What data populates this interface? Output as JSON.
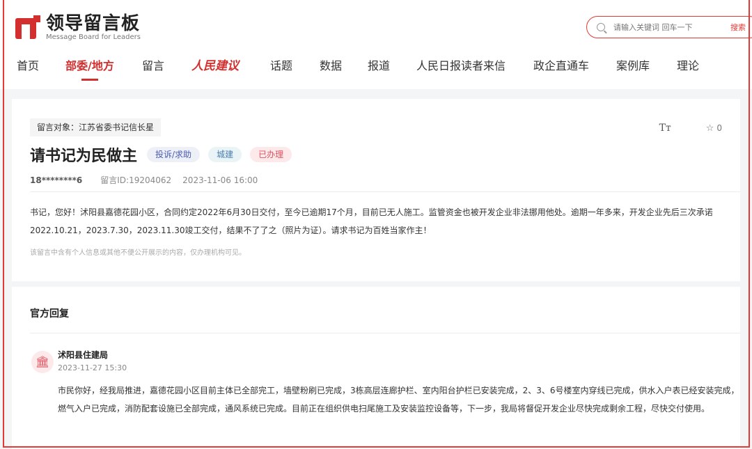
{
  "header": {
    "logo_cn": "领导留言板",
    "logo_en": "Message Board for Leaders",
    "search_placeholder": "请输入关键词 回车一下",
    "search_button": "搜索"
  },
  "nav": {
    "items": [
      {
        "label": "首页"
      },
      {
        "label": "部委/地方"
      },
      {
        "label": "留言"
      },
      {
        "label": "人民建议"
      },
      {
        "label": "话题"
      },
      {
        "label": "数据"
      },
      {
        "label": "报道"
      },
      {
        "label": "人民日报读者来信"
      },
      {
        "label": "政企直通车"
      },
      {
        "label": "案例库"
      },
      {
        "label": "理论"
      }
    ]
  },
  "message": {
    "target": "留言对象：江苏省委书记信长星",
    "title": "请书记为民做主",
    "tags": [
      "投诉/求助",
      "城建",
      "已办理"
    ],
    "font_icon": "Tт",
    "star_count": "0",
    "user": "18********6",
    "message_id": "留言ID:19204062",
    "time": "2023-11-06 16:00",
    "content": "书记，您好！沭阳县嘉德花园小区，合同约定2022年6月30日交付，至今已逾期17个月，目前已无人施工。监管资金也被开发企业非法挪用他处。逾期一年多来，开发企业先后三次承诺2022.10.21，2023.7.30，2023.11.30竣工交付，结果不了了之（照片为证）。请求书记为百姓当家作主！",
    "note": "该留言中含有个人信息或其他不便公开展示的内容，仅办理机构可见。"
  },
  "reply": {
    "heading": "官方回复",
    "org": "沭阳县住建局",
    "time": "2023-11-27 15:30",
    "content": "市民你好，经我局推进，嘉德花园小区目前主体已全部完工，墙壁粉刷已完成，3栋高层连廊护栏、室内阳台护栏已安装完成，2、3、6号楼室内穿线已完成，供水入户表已经安装完成，燃气入户已完成，消防配套设施已全部完成，通风系统已完成。目前正在组织供电扫尾施工及安装监控设备等，下一步，我局将督促开发企业尽快完成剩余工程，尽快交付使用。"
  },
  "colors": {
    "accent": "#d32f2f",
    "frame": "#e53935"
  }
}
